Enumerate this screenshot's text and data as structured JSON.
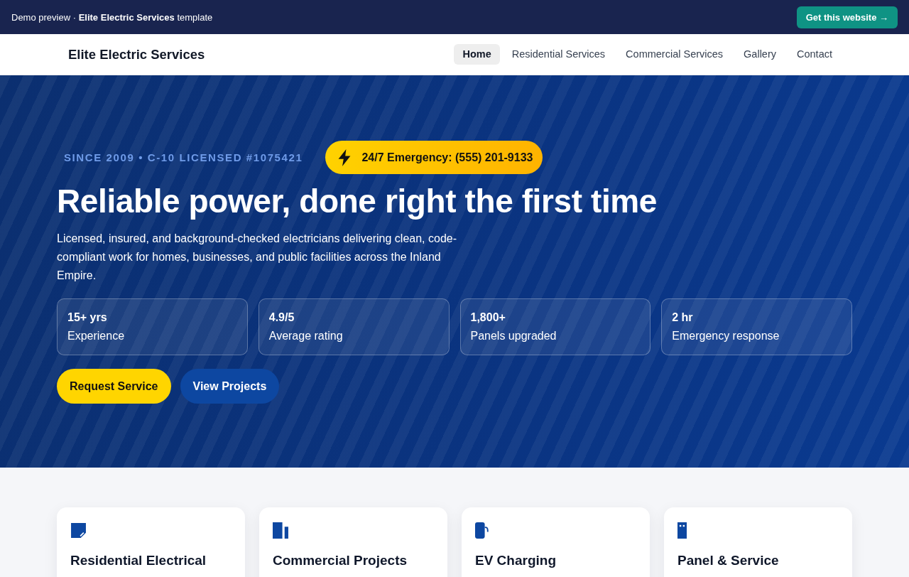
{
  "demo_bar": {
    "text": "Demo preview · **Elite Electric Services** template",
    "button": "Get this website →"
  },
  "navbar": {
    "brand": "Elite Electric Services",
    "links": [
      {
        "label": "Home",
        "selected": true
      },
      {
        "label": "Residential Services",
        "selected": false
      },
      {
        "label": "Commercial Services",
        "selected": false
      },
      {
        "label": "Gallery",
        "selected": false
      },
      {
        "label": "Contact",
        "selected": false
      }
    ]
  },
  "hero": {
    "eyebrow": "SINCE 2009 • C-10 LICENSED #1075421",
    "emergency_badge": "24/7 Emergency: (555) 201-9133",
    "title": "Reliable power, done right the first time",
    "description": "Licensed, insured, and background-checked electricians delivering clean, code-compliant work for homes, businesses, and public facilities across the Inland Empire.",
    "stats": [
      {
        "value": "15+ yrs",
        "label": "Experience"
      },
      {
        "value": "4.9/5",
        "label": "Average rating"
      },
      {
        "value": "1,800+",
        "label": "Panels upgraded"
      },
      {
        "value": "2 hr",
        "label": "Emergency response"
      }
    ],
    "buttons": [
      {
        "label": "Request Service",
        "kind": "primary"
      },
      {
        "label": "View Projects",
        "kind": "secondary"
      }
    ]
  },
  "services": [
    {
      "title": "Residential Electrical"
    },
    {
      "title": "Commercial Projects"
    },
    {
      "title": "EV Charging"
    },
    {
      "title": "Panel & Service"
    }
  ]
}
